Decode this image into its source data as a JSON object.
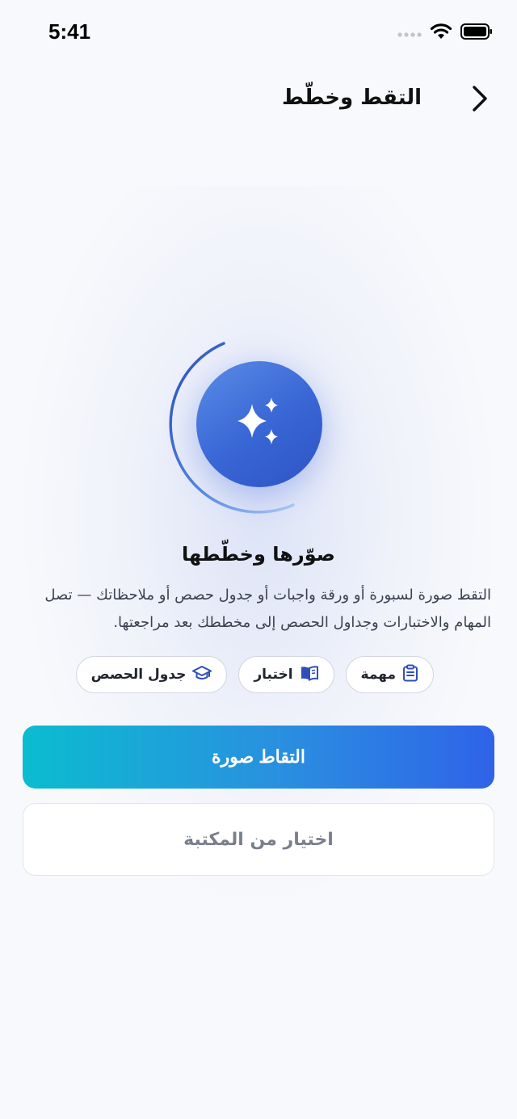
{
  "status_bar": {
    "time": "5:41",
    "icons": [
      "cellular-dots-icon",
      "wifi-icon",
      "battery-icon"
    ]
  },
  "nav": {
    "title": "التقط وخطّط",
    "back_icon": "chevron-right-icon"
  },
  "hero": {
    "icon": "sparkles-icon",
    "colors": {
      "circle_start": "#5b8de6",
      "circle_end": "#2e53c4"
    }
  },
  "content": {
    "heading": "صوّرها وخطّطها",
    "description": "التقط صورة لسبورة أو ورقة واجبات أو جدول حصص أو ملاحظاتك — تصل المهام والاختبارات وجداول الحصص إلى مخططك بعد مراجعتها."
  },
  "chips": [
    {
      "label": "مهمة",
      "icon": "clipboard-icon"
    },
    {
      "label": "اختبار",
      "icon": "book-open-icon"
    },
    {
      "label": "جدول الحصص",
      "icon": "graduation-cap-icon"
    }
  ],
  "actions": {
    "capture_label": "التقاط صورة",
    "library_label": "اختيار من المكتبة"
  },
  "colors": {
    "primary_gradient_start": "#0bbcd0",
    "primary_gradient_end": "#2f63e8",
    "chip_icon": "#2f4fb8"
  }
}
